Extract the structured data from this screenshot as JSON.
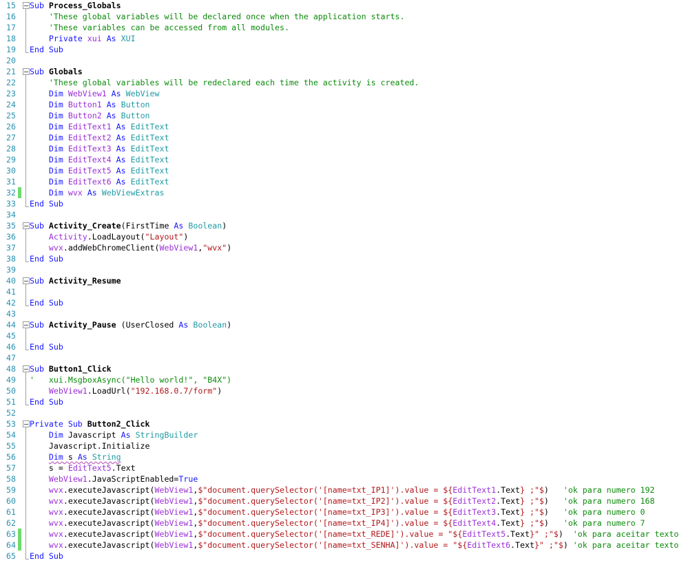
{
  "colors": {
    "keyword": "#1515ff",
    "variable": "#9b2fd6",
    "type": "#1f9aa3",
    "comment": "#0b8a0b",
    "string": "#b0171a",
    "line_number": "#2b91af",
    "changed_line_marker": "#6ddc6d"
  },
  "code_lines": [
    {
      "n": "15",
      "fold": "start",
      "tokens": [
        [
          "k",
          "Sub "
        ],
        [
          "b",
          "Process_Globals"
        ]
      ]
    },
    {
      "n": "16",
      "fold": "mid",
      "tokens": [
        [
          "c",
          "    'These global variables will be declared once when the application starts."
        ]
      ]
    },
    {
      "n": "17",
      "fold": "mid",
      "tokens": [
        [
          "c",
          "    'These variables can be accessed from all modules."
        ]
      ]
    },
    {
      "n": "18",
      "fold": "mid",
      "tokens": [
        [
          "k",
          "    Private "
        ],
        [
          "v",
          "xui"
        ],
        [
          "p",
          " "
        ],
        [
          "k",
          "As "
        ],
        [
          "t",
          "XUI"
        ]
      ]
    },
    {
      "n": "19",
      "fold": "end",
      "tokens": [
        [
          "k",
          "End Sub"
        ]
      ]
    },
    {
      "n": "20",
      "tokens": []
    },
    {
      "n": "21",
      "fold": "start",
      "tokens": [
        [
          "k",
          "Sub "
        ],
        [
          "b",
          "Globals"
        ]
      ]
    },
    {
      "n": "22",
      "fold": "mid",
      "tokens": [
        [
          "c",
          "    'These global variables will be redeclared each time the activity is created."
        ]
      ]
    },
    {
      "n": "23",
      "fold": "mid",
      "tokens": [
        [
          "k",
          "    Dim "
        ],
        [
          "v",
          "WebView1"
        ],
        [
          "p",
          " "
        ],
        [
          "k",
          "As "
        ],
        [
          "t",
          "WebView"
        ]
      ]
    },
    {
      "n": "24",
      "fold": "mid",
      "tokens": [
        [
          "k",
          "    Dim "
        ],
        [
          "v",
          "Button1"
        ],
        [
          "p",
          " "
        ],
        [
          "k",
          "As "
        ],
        [
          "t",
          "Button"
        ]
      ]
    },
    {
      "n": "25",
      "fold": "mid",
      "tokens": [
        [
          "k",
          "    Dim "
        ],
        [
          "v",
          "Button2"
        ],
        [
          "p",
          " "
        ],
        [
          "k",
          "As "
        ],
        [
          "t",
          "Button"
        ]
      ]
    },
    {
      "n": "26",
      "fold": "mid",
      "tokens": [
        [
          "k",
          "    Dim "
        ],
        [
          "v",
          "EditText1"
        ],
        [
          "p",
          " "
        ],
        [
          "k",
          "As "
        ],
        [
          "t",
          "EditText"
        ]
      ]
    },
    {
      "n": "27",
      "fold": "mid",
      "tokens": [
        [
          "k",
          "    Dim "
        ],
        [
          "v",
          "EditText2"
        ],
        [
          "p",
          " "
        ],
        [
          "k",
          "As "
        ],
        [
          "t",
          "EditText"
        ]
      ]
    },
    {
      "n": "28",
      "fold": "mid",
      "tokens": [
        [
          "k",
          "    Dim "
        ],
        [
          "v",
          "EditText3"
        ],
        [
          "p",
          " "
        ],
        [
          "k",
          "As "
        ],
        [
          "t",
          "EditText"
        ]
      ]
    },
    {
      "n": "29",
      "fold": "mid",
      "tokens": [
        [
          "k",
          "    Dim "
        ],
        [
          "v",
          "EditText4"
        ],
        [
          "p",
          " "
        ],
        [
          "k",
          "As "
        ],
        [
          "t",
          "EditText"
        ]
      ]
    },
    {
      "n": "30",
      "fold": "mid",
      "tokens": [
        [
          "k",
          "    Dim "
        ],
        [
          "v",
          "EditText5"
        ],
        [
          "p",
          " "
        ],
        [
          "k",
          "As "
        ],
        [
          "t",
          "EditText"
        ]
      ]
    },
    {
      "n": "31",
      "fold": "mid",
      "tokens": [
        [
          "k",
          "    Dim "
        ],
        [
          "v",
          "EditText6"
        ],
        [
          "p",
          " "
        ],
        [
          "k",
          "As "
        ],
        [
          "t",
          "EditText"
        ]
      ]
    },
    {
      "n": "32",
      "fold": "mid",
      "changed": true,
      "tokens": [
        [
          "k",
          "    Dim "
        ],
        [
          "v",
          "wvx"
        ],
        [
          "p",
          " "
        ],
        [
          "k",
          "As "
        ],
        [
          "t",
          "WebViewExtras"
        ]
      ]
    },
    {
      "n": "33",
      "fold": "end",
      "tokens": [
        [
          "k",
          "End Sub"
        ]
      ]
    },
    {
      "n": "34",
      "tokens": []
    },
    {
      "n": "35",
      "fold": "start",
      "tokens": [
        [
          "k",
          "Sub "
        ],
        [
          "b",
          "Activity_Create"
        ],
        [
          "p",
          "(FirstTime "
        ],
        [
          "k",
          "As "
        ],
        [
          "t",
          "Boolean"
        ],
        [
          "p",
          ")"
        ]
      ]
    },
    {
      "n": "36",
      "fold": "mid",
      "tokens": [
        [
          "v",
          "    Activity"
        ],
        [
          "p",
          ".LoadLayout("
        ],
        [
          "s",
          "\"Layout\""
        ],
        [
          "p",
          ")"
        ]
      ]
    },
    {
      "n": "37",
      "fold": "mid",
      "tokens": [
        [
          "v",
          "    wvx"
        ],
        [
          "p",
          ".addWebChromeClient("
        ],
        [
          "v",
          "WebView1"
        ],
        [
          "p",
          ","
        ],
        [
          "s",
          "\"wvx\""
        ],
        [
          "p",
          ")"
        ]
      ]
    },
    {
      "n": "38",
      "fold": "end",
      "tokens": [
        [
          "k",
          "End Sub"
        ]
      ]
    },
    {
      "n": "39",
      "tokens": []
    },
    {
      "n": "40",
      "fold": "start",
      "tokens": [
        [
          "k",
          "Sub "
        ],
        [
          "b",
          "Activity_Resume"
        ]
      ]
    },
    {
      "n": "41",
      "fold": "mid",
      "tokens": []
    },
    {
      "n": "42",
      "fold": "end",
      "tokens": [
        [
          "k",
          "End Sub"
        ]
      ]
    },
    {
      "n": "43",
      "tokens": []
    },
    {
      "n": "44",
      "fold": "start",
      "tokens": [
        [
          "k",
          "Sub "
        ],
        [
          "b",
          "Activity_Pause"
        ],
        [
          "p",
          " (UserClosed "
        ],
        [
          "k",
          "As "
        ],
        [
          "t",
          "Boolean"
        ],
        [
          "p",
          ")"
        ]
      ]
    },
    {
      "n": "45",
      "fold": "mid",
      "tokens": []
    },
    {
      "n": "46",
      "fold": "end",
      "tokens": [
        [
          "k",
          "End Sub"
        ]
      ]
    },
    {
      "n": "47",
      "tokens": []
    },
    {
      "n": "48",
      "fold": "start",
      "tokens": [
        [
          "k",
          "Sub "
        ],
        [
          "b",
          "Button1_Click"
        ]
      ]
    },
    {
      "n": "49",
      "fold": "mid",
      "tokens": [
        [
          "c",
          "'   xui.MsgboxAsync(\"Hello world!\", \"B4X\")"
        ]
      ]
    },
    {
      "n": "50",
      "fold": "mid",
      "tokens": [
        [
          "v",
          "    WebView1"
        ],
        [
          "p",
          ".LoadUrl("
        ],
        [
          "s",
          "\"192.168.0.7/form\""
        ],
        [
          "p",
          ")"
        ]
      ]
    },
    {
      "n": "51",
      "fold": "end",
      "tokens": [
        [
          "k",
          "End Sub"
        ]
      ]
    },
    {
      "n": "52",
      "tokens": []
    },
    {
      "n": "53",
      "fold": "start",
      "tokens": [
        [
          "k",
          "Private Sub "
        ],
        [
          "b",
          "Button2_Click"
        ]
      ]
    },
    {
      "n": "54",
      "fold": "mid",
      "tokens": [
        [
          "k",
          "    Dim "
        ],
        [
          "p",
          "Javascript "
        ],
        [
          "k",
          "As "
        ],
        [
          "t",
          "StringBuilder"
        ]
      ]
    },
    {
      "n": "55",
      "fold": "mid",
      "tokens": [
        [
          "p",
          "    Javascript.Initialize"
        ]
      ]
    },
    {
      "n": "56",
      "fold": "mid",
      "tokens": [
        [
          "p",
          "    "
        ],
        [
          "k",
          "Dim ",
          "u"
        ],
        [
          "p",
          "s ",
          "u"
        ],
        [
          "k",
          "As ",
          "u"
        ],
        [
          "t",
          "String",
          "u"
        ]
      ]
    },
    {
      "n": "57",
      "fold": "mid",
      "tokens": [
        [
          "p",
          "    s = "
        ],
        [
          "v",
          "EditText5"
        ],
        [
          "p",
          ".Text"
        ]
      ]
    },
    {
      "n": "58",
      "fold": "mid",
      "tokens": [
        [
          "v",
          "    WebView1"
        ],
        [
          "p",
          ".JavaScriptEnabled="
        ],
        [
          "k",
          "True"
        ]
      ]
    },
    {
      "n": "59",
      "fold": "mid",
      "tokens": [
        [
          "v",
          "    wvx"
        ],
        [
          "p",
          ".executeJavascript("
        ],
        [
          "v",
          "WebView1"
        ],
        [
          "p",
          ","
        ],
        [
          "s",
          "$\"document.querySelector('[name=txt_IP1]').value = ${"
        ],
        [
          "v",
          "EditText1"
        ],
        [
          "p",
          ".Text"
        ],
        [
          "s",
          "} ;\"$"
        ],
        [
          "p",
          ")"
        ],
        [
          "c",
          "   'ok para numero 192"
        ]
      ]
    },
    {
      "n": "60",
      "fold": "mid",
      "tokens": [
        [
          "v",
          "    wvx"
        ],
        [
          "p",
          ".executeJavascript("
        ],
        [
          "v",
          "WebView1"
        ],
        [
          "p",
          ","
        ],
        [
          "s",
          "$\"document.querySelector('[name=txt_IP2]').value = ${"
        ],
        [
          "v",
          "EditText2"
        ],
        [
          "p",
          ".Text"
        ],
        [
          "s",
          "} ;\"$"
        ],
        [
          "p",
          ")"
        ],
        [
          "c",
          "   'ok para numero 168"
        ]
      ]
    },
    {
      "n": "61",
      "fold": "mid",
      "tokens": [
        [
          "v",
          "    wvx"
        ],
        [
          "p",
          ".executeJavascript("
        ],
        [
          "v",
          "WebView1"
        ],
        [
          "p",
          ","
        ],
        [
          "s",
          "$\"document.querySelector('[name=txt_IP3]').value = ${"
        ],
        [
          "v",
          "EditText3"
        ],
        [
          "p",
          ".Text"
        ],
        [
          "s",
          "} ;\"$"
        ],
        [
          "p",
          ")"
        ],
        [
          "c",
          "   'ok para numero 0"
        ]
      ]
    },
    {
      "n": "62",
      "fold": "mid",
      "tokens": [
        [
          "v",
          "    wvx"
        ],
        [
          "p",
          ".executeJavascript("
        ],
        [
          "v",
          "WebView1"
        ],
        [
          "p",
          ","
        ],
        [
          "s",
          "$\"document.querySelector('[name=txt_IP4]').value = ${"
        ],
        [
          "v",
          "EditText4"
        ],
        [
          "p",
          ".Text"
        ],
        [
          "s",
          "} ;\"$"
        ],
        [
          "p",
          ")"
        ],
        [
          "c",
          "   'ok para numero 7"
        ]
      ]
    },
    {
      "n": "63",
      "fold": "mid",
      "changed": true,
      "tokens": [
        [
          "v",
          "    wvx"
        ],
        [
          "p",
          ".executeJavascript("
        ],
        [
          "v",
          "WebView1"
        ],
        [
          "p",
          ","
        ],
        [
          "s",
          "$\"document.querySelector('[name=txt_REDE]').value = \"${"
        ],
        [
          "v",
          "EditText5"
        ],
        [
          "p",
          ".Text"
        ],
        [
          "s",
          "}\" ;\"$"
        ],
        [
          "p",
          ")"
        ],
        [
          "c",
          "  'ok para aceitar texto"
        ]
      ]
    },
    {
      "n": "64",
      "fold": "mid",
      "changed": true,
      "tokens": [
        [
          "v",
          "    wvx"
        ],
        [
          "p",
          ".executeJavascript("
        ],
        [
          "v",
          "WebView1"
        ],
        [
          "p",
          ","
        ],
        [
          "s",
          "$\"document.querySelector('[name=txt_SENHA]').value = \"${"
        ],
        [
          "v",
          "EditText6"
        ],
        [
          "p",
          ".Text"
        ],
        [
          "s",
          "}\" ;\"$"
        ],
        [
          "p",
          ")"
        ],
        [
          "c",
          " 'ok para aceitar texto"
        ]
      ]
    },
    {
      "n": "65",
      "fold": "end",
      "tokens": [
        [
          "k",
          "End Sub"
        ]
      ]
    }
  ]
}
